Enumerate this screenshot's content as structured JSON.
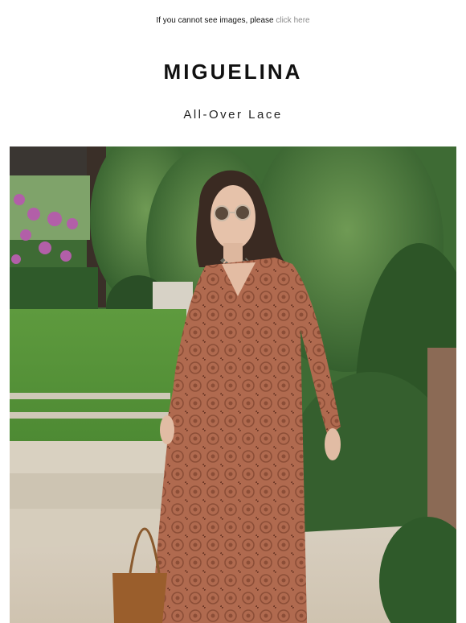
{
  "preheader": {
    "text": "If you cannot see images, please",
    "link_label": "click here"
  },
  "brand": {
    "logo_text": "MIGUELINA"
  },
  "campaign": {
    "subheading": "All-Over Lace"
  },
  "hero_image": {
    "alt": "Model in terracotta all-over lace dress with sunglasses and woven tote in a garden",
    "dress_color": "#b06a4f"
  },
  "colors": {
    "link": "#8a8a8a",
    "text": "#111111"
  }
}
